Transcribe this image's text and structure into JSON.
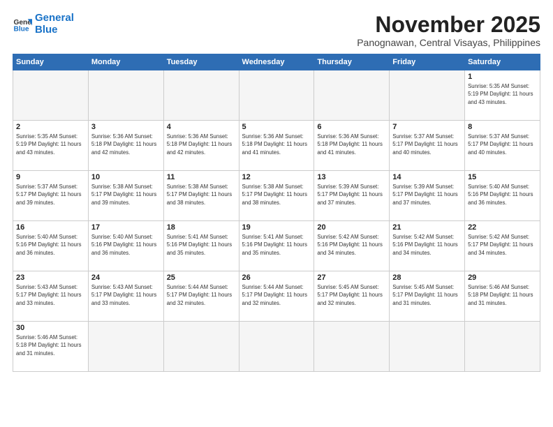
{
  "header": {
    "logo_general": "General",
    "logo_blue": "Blue",
    "month_title": "November 2025",
    "subtitle": "Panognawan, Central Visayas, Philippines"
  },
  "weekdays": [
    "Sunday",
    "Monday",
    "Tuesday",
    "Wednesday",
    "Thursday",
    "Friday",
    "Saturday"
  ],
  "weeks": [
    [
      {
        "day": "",
        "info": ""
      },
      {
        "day": "",
        "info": ""
      },
      {
        "day": "",
        "info": ""
      },
      {
        "day": "",
        "info": ""
      },
      {
        "day": "",
        "info": ""
      },
      {
        "day": "",
        "info": ""
      },
      {
        "day": "1",
        "info": "Sunrise: 5:35 AM\nSunset: 5:19 PM\nDaylight: 11 hours\nand 43 minutes."
      }
    ],
    [
      {
        "day": "2",
        "info": "Sunrise: 5:35 AM\nSunset: 5:19 PM\nDaylight: 11 hours\nand 43 minutes."
      },
      {
        "day": "3",
        "info": "Sunrise: 5:36 AM\nSunset: 5:18 PM\nDaylight: 11 hours\nand 42 minutes."
      },
      {
        "day": "4",
        "info": "Sunrise: 5:36 AM\nSunset: 5:18 PM\nDaylight: 11 hours\nand 42 minutes."
      },
      {
        "day": "5",
        "info": "Sunrise: 5:36 AM\nSunset: 5:18 PM\nDaylight: 11 hours\nand 41 minutes."
      },
      {
        "day": "6",
        "info": "Sunrise: 5:36 AM\nSunset: 5:18 PM\nDaylight: 11 hours\nand 41 minutes."
      },
      {
        "day": "7",
        "info": "Sunrise: 5:37 AM\nSunset: 5:17 PM\nDaylight: 11 hours\nand 40 minutes."
      },
      {
        "day": "8",
        "info": "Sunrise: 5:37 AM\nSunset: 5:17 PM\nDaylight: 11 hours\nand 40 minutes."
      }
    ],
    [
      {
        "day": "9",
        "info": "Sunrise: 5:37 AM\nSunset: 5:17 PM\nDaylight: 11 hours\nand 39 minutes."
      },
      {
        "day": "10",
        "info": "Sunrise: 5:38 AM\nSunset: 5:17 PM\nDaylight: 11 hours\nand 39 minutes."
      },
      {
        "day": "11",
        "info": "Sunrise: 5:38 AM\nSunset: 5:17 PM\nDaylight: 11 hours\nand 38 minutes."
      },
      {
        "day": "12",
        "info": "Sunrise: 5:38 AM\nSunset: 5:17 PM\nDaylight: 11 hours\nand 38 minutes."
      },
      {
        "day": "13",
        "info": "Sunrise: 5:39 AM\nSunset: 5:17 PM\nDaylight: 11 hours\nand 37 minutes."
      },
      {
        "day": "14",
        "info": "Sunrise: 5:39 AM\nSunset: 5:17 PM\nDaylight: 11 hours\nand 37 minutes."
      },
      {
        "day": "15",
        "info": "Sunrise: 5:40 AM\nSunset: 5:16 PM\nDaylight: 11 hours\nand 36 minutes."
      }
    ],
    [
      {
        "day": "16",
        "info": "Sunrise: 5:40 AM\nSunset: 5:16 PM\nDaylight: 11 hours\nand 36 minutes."
      },
      {
        "day": "17",
        "info": "Sunrise: 5:40 AM\nSunset: 5:16 PM\nDaylight: 11 hours\nand 36 minutes."
      },
      {
        "day": "18",
        "info": "Sunrise: 5:41 AM\nSunset: 5:16 PM\nDaylight: 11 hours\nand 35 minutes."
      },
      {
        "day": "19",
        "info": "Sunrise: 5:41 AM\nSunset: 5:16 PM\nDaylight: 11 hours\nand 35 minutes."
      },
      {
        "day": "20",
        "info": "Sunrise: 5:42 AM\nSunset: 5:16 PM\nDaylight: 11 hours\nand 34 minutes."
      },
      {
        "day": "21",
        "info": "Sunrise: 5:42 AM\nSunset: 5:16 PM\nDaylight: 11 hours\nand 34 minutes."
      },
      {
        "day": "22",
        "info": "Sunrise: 5:42 AM\nSunset: 5:17 PM\nDaylight: 11 hours\nand 34 minutes."
      }
    ],
    [
      {
        "day": "23",
        "info": "Sunrise: 5:43 AM\nSunset: 5:17 PM\nDaylight: 11 hours\nand 33 minutes."
      },
      {
        "day": "24",
        "info": "Sunrise: 5:43 AM\nSunset: 5:17 PM\nDaylight: 11 hours\nand 33 minutes."
      },
      {
        "day": "25",
        "info": "Sunrise: 5:44 AM\nSunset: 5:17 PM\nDaylight: 11 hours\nand 32 minutes."
      },
      {
        "day": "26",
        "info": "Sunrise: 5:44 AM\nSunset: 5:17 PM\nDaylight: 11 hours\nand 32 minutes."
      },
      {
        "day": "27",
        "info": "Sunrise: 5:45 AM\nSunset: 5:17 PM\nDaylight: 11 hours\nand 32 minutes."
      },
      {
        "day": "28",
        "info": "Sunrise: 5:45 AM\nSunset: 5:17 PM\nDaylight: 11 hours\nand 31 minutes."
      },
      {
        "day": "29",
        "info": "Sunrise: 5:46 AM\nSunset: 5:18 PM\nDaylight: 11 hours\nand 31 minutes."
      }
    ],
    [
      {
        "day": "30",
        "info": "Sunrise: 5:46 AM\nSunset: 5:18 PM\nDaylight: 11 hours\nand 31 minutes."
      },
      {
        "day": "",
        "info": ""
      },
      {
        "day": "",
        "info": ""
      },
      {
        "day": "",
        "info": ""
      },
      {
        "day": "",
        "info": ""
      },
      {
        "day": "",
        "info": ""
      },
      {
        "day": "",
        "info": ""
      }
    ]
  ]
}
